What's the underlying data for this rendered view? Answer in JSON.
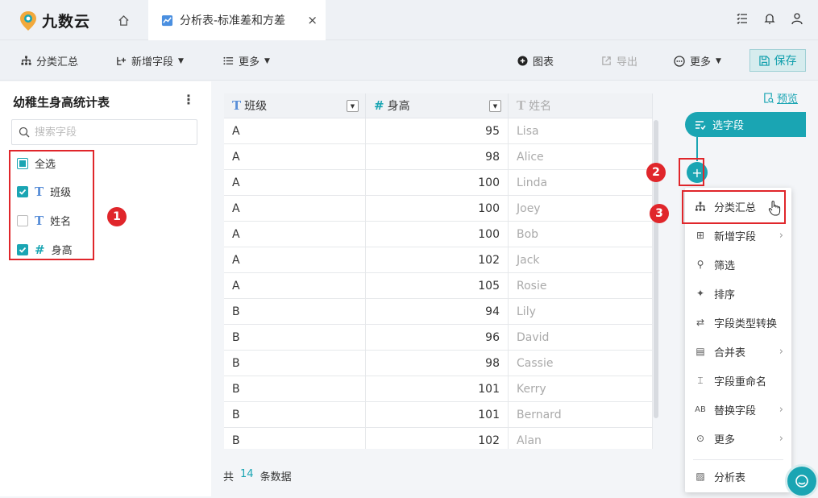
{
  "app": {
    "name": "九数云"
  },
  "tab": {
    "label": "分析表-标准差和方差",
    "close": "×"
  },
  "toolbar": {
    "group_label": "分类汇总",
    "add_field_label": "新增字段",
    "more_label": "更多",
    "chart_label": "图表",
    "export_label": "导出",
    "more2_label": "更多",
    "save_label": "保存"
  },
  "left_panel": {
    "title": "幼稚生身高统计表",
    "search_placeholder": "搜索字段",
    "select_all": "全选",
    "fields": [
      {
        "label": "班级",
        "type": "T",
        "checked": true
      },
      {
        "label": "姓名",
        "type": "T",
        "checked": false
      },
      {
        "label": "身高",
        "type": "#",
        "checked": true
      }
    ]
  },
  "table": {
    "columns": [
      {
        "label": "班级",
        "type": "T"
      },
      {
        "label": "身高",
        "type": "#"
      },
      {
        "label": "姓名",
        "type": "T"
      }
    ],
    "rows": [
      [
        "A",
        "95",
        "Lisa"
      ],
      [
        "A",
        "98",
        "Alice"
      ],
      [
        "A",
        "100",
        "Linda"
      ],
      [
        "A",
        "100",
        "Joey"
      ],
      [
        "A",
        "100",
        "Bob"
      ],
      [
        "A",
        "102",
        "Jack"
      ],
      [
        "A",
        "105",
        "Rosie"
      ],
      [
        "B",
        "94",
        "Lily"
      ],
      [
        "B",
        "96",
        "David"
      ],
      [
        "B",
        "98",
        "Cassie"
      ],
      [
        "B",
        "101",
        "Kerry"
      ],
      [
        "B",
        "101",
        "Bernard"
      ],
      [
        "B",
        "102",
        "Alan"
      ]
    ],
    "footer": {
      "prefix": "共",
      "count": "14",
      "suffix": "条数据"
    }
  },
  "right_panel": {
    "preview_label": "预览",
    "step_label": "选字段",
    "plus": "+",
    "menu": [
      {
        "label": "分类汇总",
        "icon": "group-icon",
        "submenu": false
      },
      {
        "label": "新增字段",
        "icon": "add-field-icon",
        "submenu": true
      },
      {
        "label": "筛选",
        "icon": "filter-icon",
        "submenu": false
      },
      {
        "label": "排序",
        "icon": "sort-icon",
        "submenu": false
      },
      {
        "label": "字段类型转换",
        "icon": "shuffle-icon",
        "submenu": false
      },
      {
        "label": "合并表",
        "icon": "merge-icon",
        "submenu": true
      },
      {
        "label": "字段重命名",
        "icon": "rename-icon",
        "submenu": false
      },
      {
        "label": "替换字段",
        "icon": "replace-icon",
        "submenu": true
      },
      {
        "label": "更多",
        "icon": "more-icon",
        "submenu": true
      },
      {
        "label": "分析表",
        "icon": "chart-icon",
        "submenu": false
      }
    ]
  },
  "annotations": {
    "one": "1",
    "two": "2",
    "three": "3"
  },
  "colors": {
    "accent": "#1aa5b3",
    "annotation_red": "#e0262b"
  }
}
